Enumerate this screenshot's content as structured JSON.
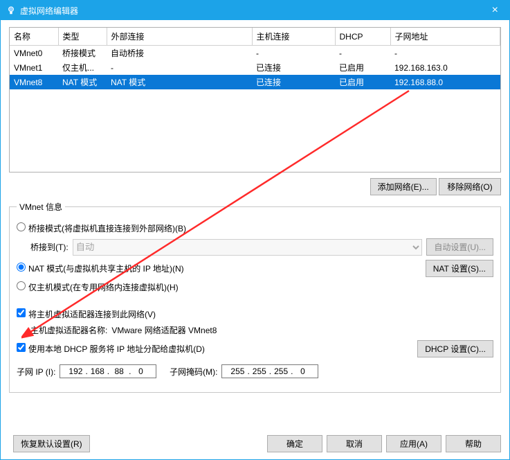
{
  "window": {
    "title": "虚拟网络编辑器",
    "close": "×"
  },
  "grid": {
    "headers": [
      "名称",
      "类型",
      "外部连接",
      "主机连接",
      "DHCP",
      "子网地址"
    ],
    "rows": [
      {
        "name": "VMnet0",
        "type": "桥接模式",
        "ext": "自动桥接",
        "host": "-",
        "dhcp": "-",
        "subnet": "-",
        "selected": false
      },
      {
        "name": "VMnet1",
        "type": "仅主机...",
        "ext": "-",
        "host": "已连接",
        "dhcp": "已启用",
        "subnet": "192.168.163.0",
        "selected": false
      },
      {
        "name": "VMnet8",
        "type": "NAT 模式",
        "ext": "NAT 模式",
        "host": "已连接",
        "dhcp": "已启用",
        "subnet": "192.168.88.0",
        "selected": true
      }
    ]
  },
  "buttons": {
    "add_net": "添加网络(E)...",
    "remove_net": "移除网络(O)",
    "auto_settings": "自动设置(U)...",
    "nat_settings": "NAT 设置(S)...",
    "dhcp_settings": "DHCP 设置(C)...",
    "restore": "恢复默认设置(R)",
    "ok": "确定",
    "cancel": "取消",
    "apply": "应用(A)",
    "help": "帮助"
  },
  "info": {
    "legend": "VMnet 信息",
    "radio_bridged": "桥接模式(将虚拟机直接连接到外部网络)(B)",
    "bridged_to_label": "桥接到(T):",
    "bridged_to_value": "自动",
    "radio_nat": "NAT 模式(与虚拟机共享主机的 IP 地址)(N)",
    "radio_hostonly": "仅主机模式(在专用网络内连接虚拟机)(H)",
    "chk_connect_host": "将主机虚拟适配器连接到此网络(V)",
    "adapter_name_label": "主机虚拟适配器名称:",
    "adapter_name_value": "VMware 网络适配器 VMnet8",
    "chk_dhcp": "使用本地 DHCP 服务将 IP 地址分配给虚拟机(D)",
    "subnet_ip_label": "子网 IP (I):",
    "subnet_ip": [
      "192",
      "168",
      "88",
      "0"
    ],
    "subnet_mask_label": "子网掩码(M):",
    "subnet_mask": [
      "255",
      "255",
      "255",
      "0"
    ]
  }
}
